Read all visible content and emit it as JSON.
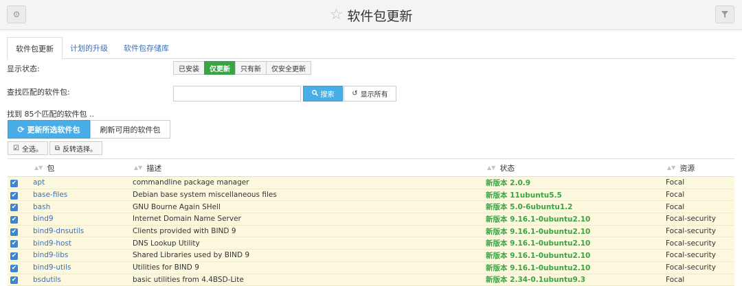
{
  "header": {
    "title": "软件包更新",
    "left_icon": "gear-icon",
    "right_icon": "filter-icon",
    "star_icon": "star-outline-icon"
  },
  "tabs": [
    {
      "label": "软件包更新",
      "active": true
    },
    {
      "label": "计划的升级",
      "active": false
    },
    {
      "label": "软件包存储库",
      "active": false
    }
  ],
  "display_status": {
    "label": "显示状态:",
    "options": [
      "已安装",
      "仅更新",
      "只有新",
      "仅安全更新"
    ],
    "selected": "仅更新"
  },
  "search": {
    "label": "查找匹配的软件包:",
    "value": "",
    "placeholder": "",
    "search_button": "搜索",
    "show_all_button": "显示所有"
  },
  "result_text": "找到 85个匹配的软件包 ..",
  "actions": {
    "update_selected": "更新所选软件包",
    "refresh_available": "刷新可用的软件包",
    "select_all": "全选。",
    "invert_selection": "反转选择。"
  },
  "table": {
    "columns": [
      "包",
      "描述",
      "状态",
      "资源"
    ],
    "rows": [
      {
        "package": "apt",
        "description": "commandline package manager",
        "status": "新版本 2.0.9",
        "source": "Focal",
        "checked": true
      },
      {
        "package": "base-files",
        "description": "Debian base system miscellaneous files",
        "status": "新版本 11ubuntu5.5",
        "source": "Focal",
        "checked": true
      },
      {
        "package": "bash",
        "description": "GNU Bourne Again SHell",
        "status": "新版本 5.0-6ubuntu1.2",
        "source": "Focal",
        "checked": true
      },
      {
        "package": "bind9",
        "description": "Internet Domain Name Server",
        "status": "新版本 9.16.1-0ubuntu2.10",
        "source": "Focal-security",
        "checked": true
      },
      {
        "package": "bind9-dnsutils",
        "description": "Clients provided with BIND 9",
        "status": "新版本 9.16.1-0ubuntu2.10",
        "source": "Focal-security",
        "checked": true
      },
      {
        "package": "bind9-host",
        "description": "DNS Lookup Utility",
        "status": "新版本 9.16.1-0ubuntu2.10",
        "source": "Focal-security",
        "checked": true
      },
      {
        "package": "bind9-libs",
        "description": "Shared Libraries used by BIND 9",
        "status": "新版本 9.16.1-0ubuntu2.10",
        "source": "Focal-security",
        "checked": true
      },
      {
        "package": "bind9-utils",
        "description": "Utilities for BIND 9",
        "status": "新版本 9.16.1-0ubuntu2.10",
        "source": "Focal-security",
        "checked": true
      },
      {
        "package": "bsdutils",
        "description": "basic utilities from 4.4BSD-Lite",
        "status": "新版本 2.34-0.1ubuntu9.3",
        "source": "Focal",
        "checked": true
      }
    ]
  },
  "colors": {
    "accent_blue": "#49aee8",
    "active_green": "#3aa343",
    "row_highlight": "#fcf8dd",
    "link_blue": "#3b6fb6"
  }
}
